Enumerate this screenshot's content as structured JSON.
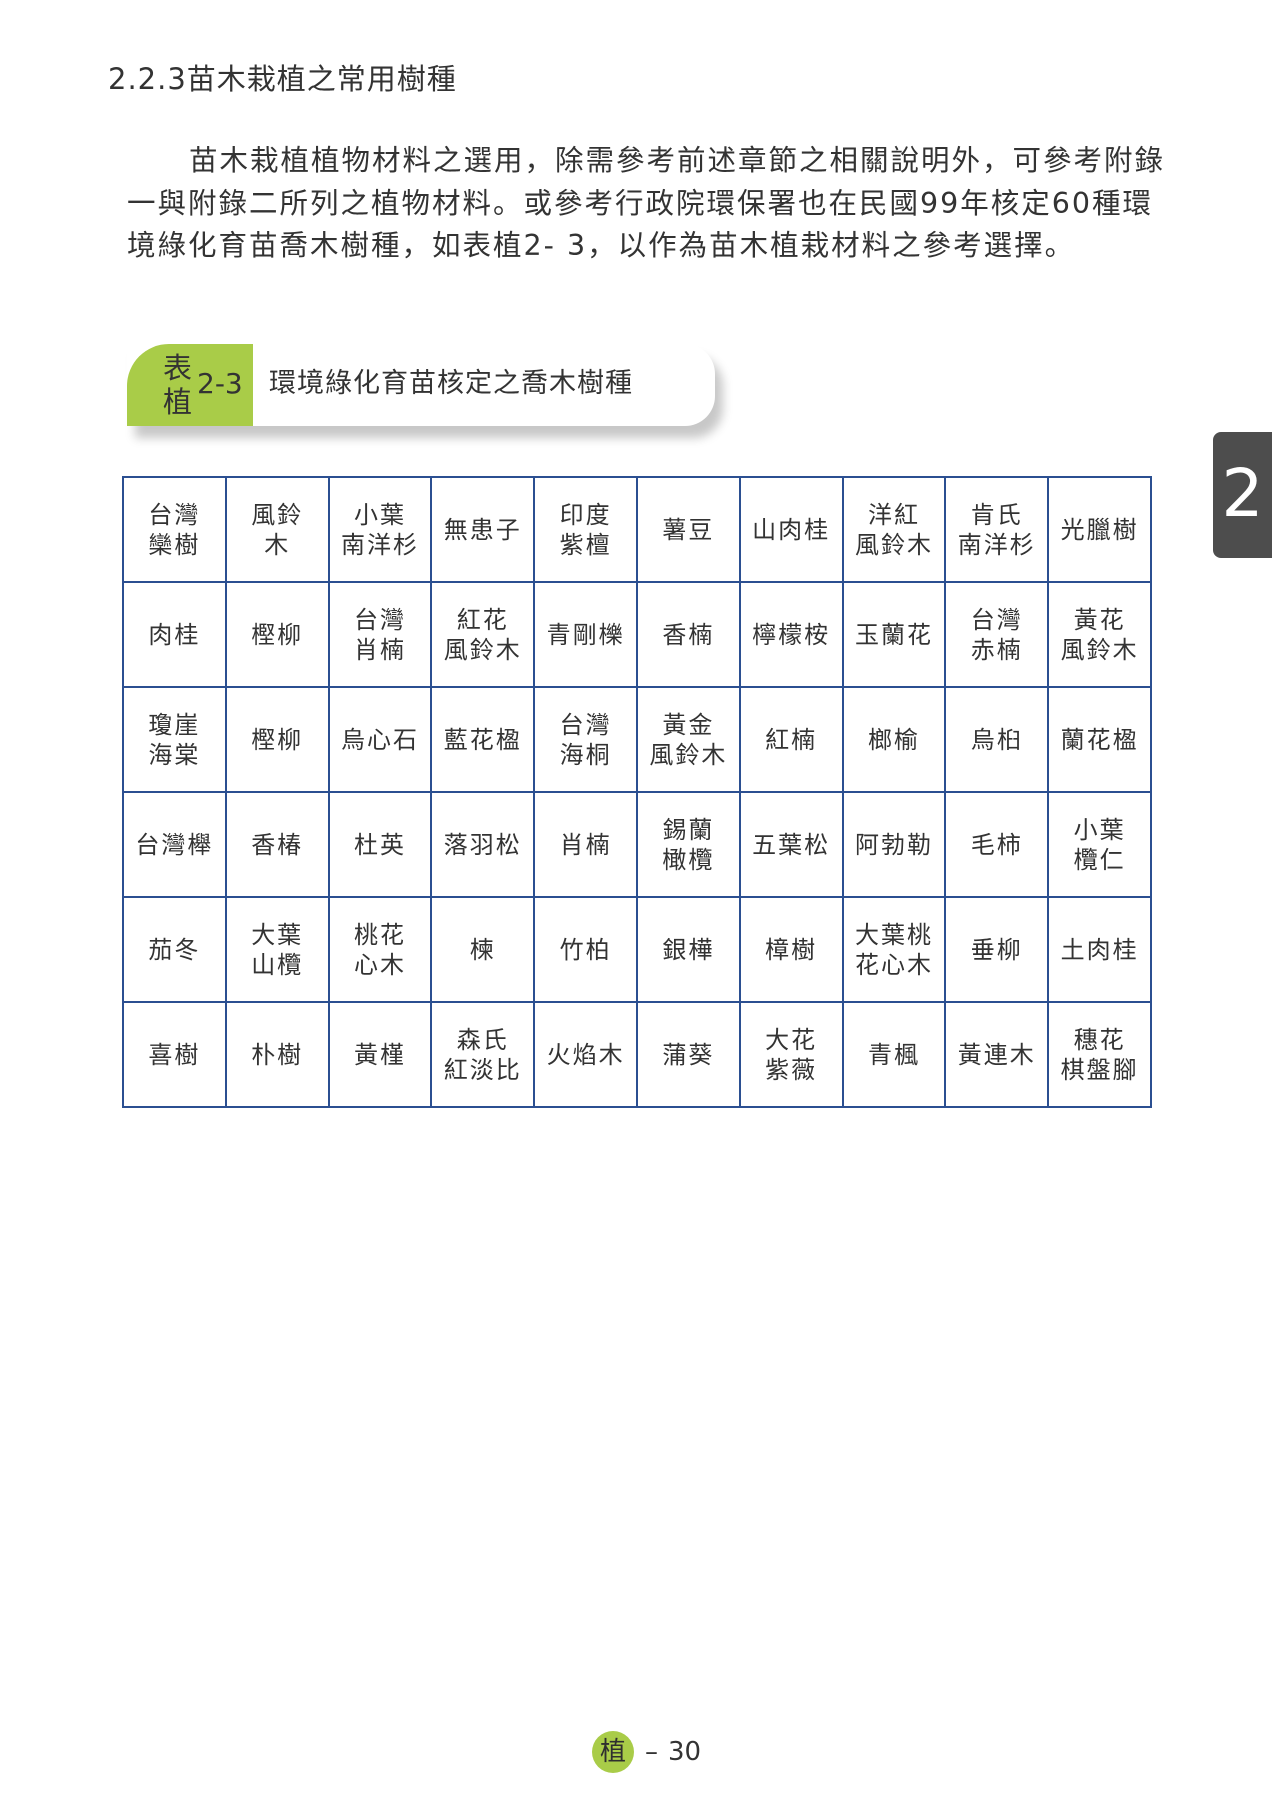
{
  "section": {
    "heading": "2.2.3苗木栽植之常用樹種",
    "paragraph": "苗木栽植植物材料之選用，除需參考前述章節之相關說明外，可參考附錄一與附錄二所列之植物材料。或參考行政院環保署也在民國99年核定60種環境綠化育苗喬木樹種，如表植2- 3，以作為苗木植栽材料之參考選擇。"
  },
  "caption": {
    "tag_top": "表",
    "tag_bottom": "植",
    "number": "2-3",
    "title": "環境綠化育苗核定之喬木樹種"
  },
  "side_tab": {
    "number": "2"
  },
  "table": {
    "rows": [
      [
        "台灣\n欒樹",
        "風鈴\n木",
        "小葉\n南洋杉",
        "無患子",
        "印度\n紫檀",
        "薯豆",
        "山肉桂",
        "洋紅\n風鈴木",
        "肯氏\n南洋杉",
        "光臘樹"
      ],
      [
        "肉桂",
        "樫柳",
        "台灣\n肖楠",
        "紅花\n風鈴木",
        "青剛櫟",
        "香楠",
        "檸檬桉",
        "玉蘭花",
        "台灣\n赤楠",
        "黃花\n風鈴木"
      ],
      [
        "瓊崖\n海棠",
        "樫柳",
        "烏心石",
        "藍花楹",
        "台灣\n海桐",
        "黃金\n風鈴木",
        "紅楠",
        "榔榆",
        "烏桕",
        "蘭花楹"
      ],
      [
        "台灣櫸",
        "香椿",
        "杜英",
        "落羽松",
        "肖楠",
        "錫蘭\n橄欖",
        "五葉松",
        "阿勃勒",
        "毛柿",
        "小葉\n欖仁"
      ],
      [
        "茄冬",
        "大葉\n山欖",
        "桃花\n心木",
        "楝",
        "竹柏",
        "銀樺",
        "樟樹",
        "大葉桃\n花心木",
        "垂柳",
        "土肉桂"
      ],
      [
        "喜樹",
        "朴樹",
        "黃槿",
        "森氏\n紅淡比",
        "火焰木",
        "蒲葵",
        "大花\n紫薇",
        "青楓",
        "黃連木",
        "穗花\n棋盤腳"
      ]
    ]
  },
  "footer": {
    "badge": "植",
    "separator": "–",
    "page_number": "30"
  },
  "colors": {
    "accent_green": "#a9cc48",
    "table_border": "#2b4f91",
    "tab_gray": "#4d4d4d"
  }
}
